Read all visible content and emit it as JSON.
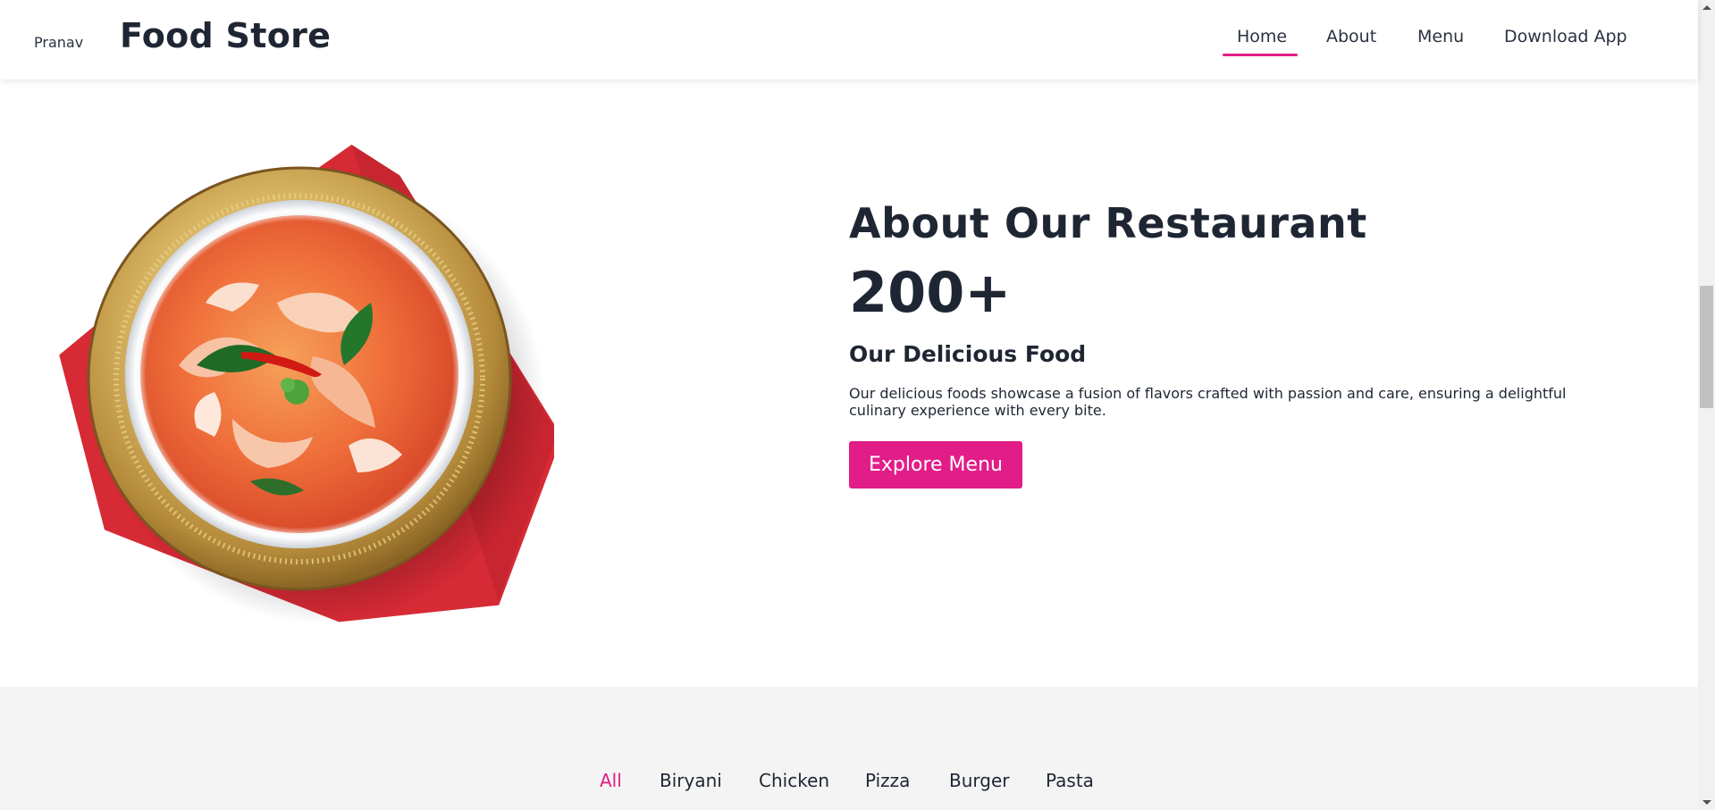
{
  "header": {
    "user_name": "Pranav",
    "brand": "Food Store",
    "nav": [
      {
        "label": "Home",
        "active": true
      },
      {
        "label": "About",
        "active": false
      },
      {
        "label": "Menu",
        "active": false
      },
      {
        "label": "Download App",
        "active": false
      }
    ]
  },
  "about": {
    "title": "About Our Restaurant",
    "count": "200+",
    "subtitle": "Our Delicious Food",
    "description": "Our delicious foods showcase a fusion of flavors crafted with passion and care, ensuring a delightful culinary experience with every bite.",
    "button_label": "Explore Menu",
    "image_alt": "bowl of shrimp soup"
  },
  "menu_filters": {
    "tabs": [
      "All",
      "Biryani",
      "Chicken",
      "Pizza",
      "Burger",
      "Pasta"
    ],
    "active": "All"
  },
  "colors": {
    "accent": "#e21d88",
    "text": "#1f2633",
    "section_bg": "#f4f4f4"
  }
}
